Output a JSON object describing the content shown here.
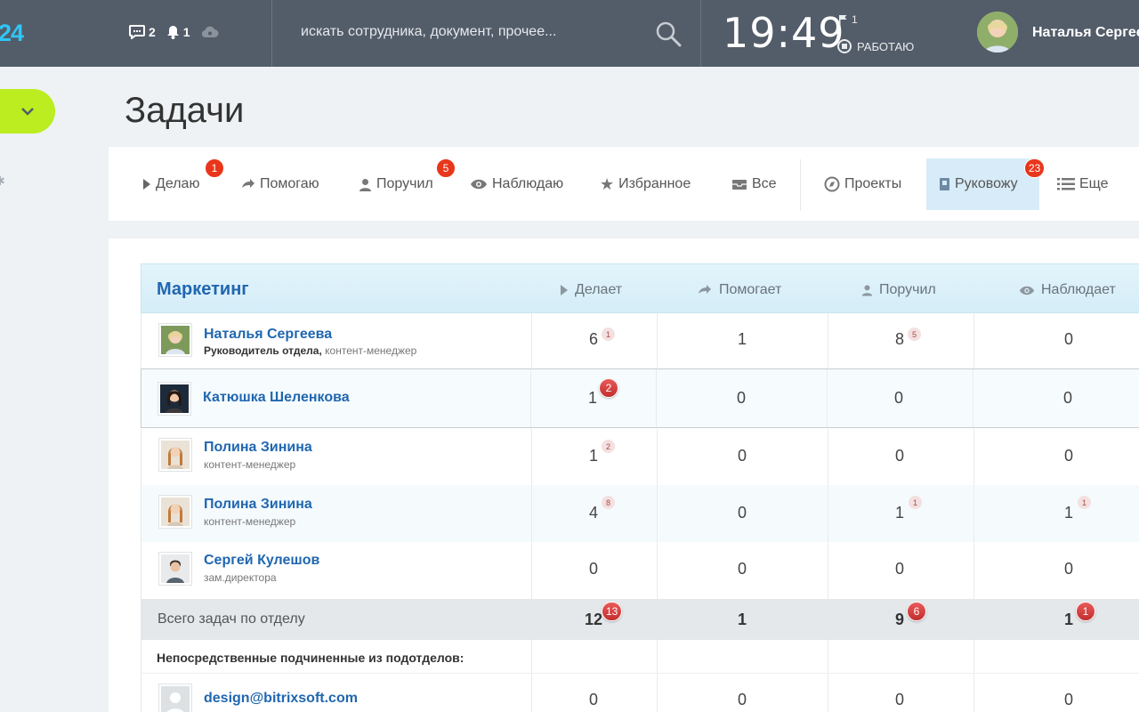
{
  "header": {
    "logo": "24",
    "messages_count": "2",
    "notifications_count": "1",
    "search_placeholder": "искать сотрудника, документ, прочее...",
    "time": "19:49",
    "flag_count": "1",
    "work_status": "РАБОТАЮ",
    "user_name": "Наталья Сергеева"
  },
  "page": {
    "title": "Задачи"
  },
  "tabs": [
    {
      "label": "Делаю",
      "badge": "1",
      "icon": "play-icon"
    },
    {
      "label": "Помогаю",
      "badge": "",
      "icon": "arrow-right-icon"
    },
    {
      "label": "Поручил",
      "badge": "5",
      "icon": "person-icon"
    },
    {
      "label": "Наблюдаю",
      "badge": "",
      "icon": "eye-icon"
    },
    {
      "label": "Избранное",
      "badge": "",
      "icon": "star-icon"
    },
    {
      "label": "Все",
      "badge": "",
      "icon": "inbox-icon"
    },
    {
      "label": "Проекты",
      "badge": "",
      "icon": "compass-icon"
    },
    {
      "label": "Руковожу",
      "badge": "23",
      "icon": "book-icon",
      "active": true
    },
    {
      "label": "Еще",
      "badge": "",
      "icon": "list-icon"
    }
  ],
  "table": {
    "department": "Маркетинг",
    "columns": [
      "Делает",
      "Помогает",
      "Поручил",
      "Наблюдает"
    ],
    "rows": [
      {
        "name": "Наталья Сергеева",
        "position_bold": "Руководитель отдела,",
        "position": "контент-менеджер",
        "doing": "6",
        "doing_sup": "1",
        "helping": "1",
        "assigned": "8",
        "assigned_sup": "5",
        "watching": "0",
        "watching_sup": ""
      },
      {
        "name": "Катюшка Шеленкова",
        "position_bold": "",
        "position": "",
        "doing": "1",
        "doing_bubble": "2",
        "helping": "0",
        "assigned": "0",
        "watching": "0"
      },
      {
        "name": "Полина Зинина",
        "position_bold": "",
        "position": "контент-менеджер",
        "doing": "1",
        "doing_sup": "2",
        "helping": "0",
        "assigned": "0",
        "watching": "0"
      },
      {
        "name": "Полина Зинина",
        "position_bold": "",
        "position": "контент-менеджер",
        "doing": "4",
        "doing_sup": "8",
        "helping": "0",
        "assigned": "1",
        "assigned_sup": "1",
        "watching": "1",
        "watching_sup": "1"
      },
      {
        "name": "Сергей Кулешов",
        "position_bold": "",
        "position": "зам.директора",
        "doing": "0",
        "helping": "0",
        "assigned": "0",
        "watching": "0"
      }
    ],
    "total": {
      "label": "Всего задач по отделу",
      "doing": "12",
      "doing_bubble": "13",
      "helping": "1",
      "assigned": "9",
      "assigned_bubble": "6",
      "watching": "1",
      "watching_bubble": "1"
    },
    "subordinates_label": "Непосредственные подчиненные из подотделов:",
    "sub_row": {
      "name": "design@bitrixsoft.com",
      "doing": "0",
      "helping": "0",
      "assigned": "0",
      "watching": "0"
    }
  },
  "colors": {
    "header_bg": "#535c69",
    "accent_green": "#bbed21",
    "link_blue": "#2067b0",
    "badge_red": "#e8361b",
    "active_tab": "#d7ecf8"
  }
}
